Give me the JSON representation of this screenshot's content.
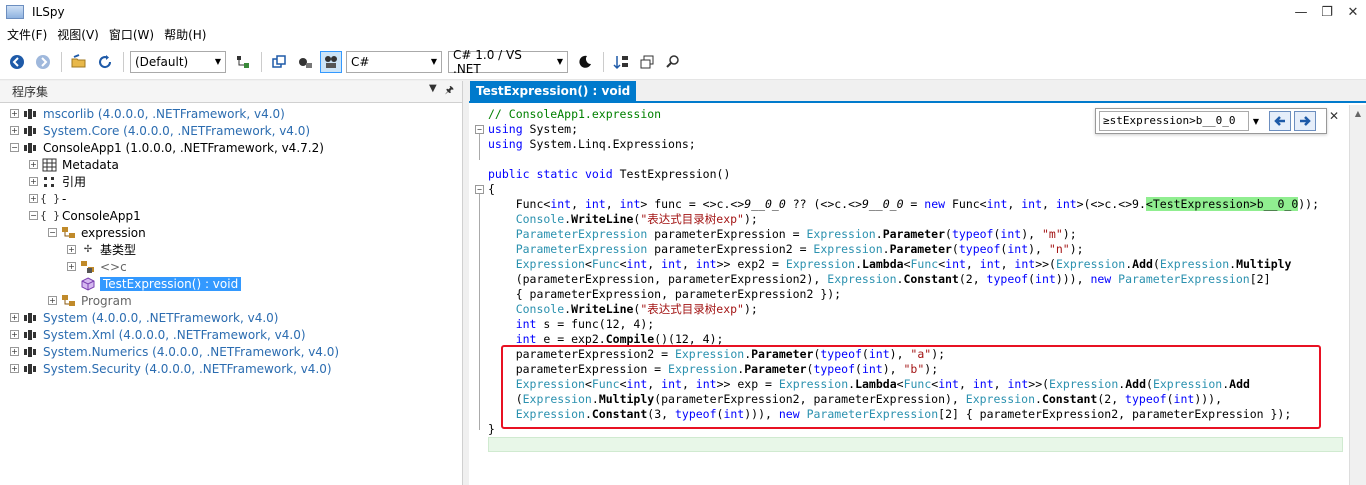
{
  "window": {
    "title": "ILSpy",
    "minimize": "—",
    "restore": "❐",
    "close": "✕"
  },
  "menu": [
    "文件(F)",
    "视图(V)",
    "窗口(W)",
    "帮助(H)"
  ],
  "toolbar": {
    "filter_combo": "(Default)",
    "language_combo": "C#",
    "version_combo": "C# 1.0 / VS .NET"
  },
  "left_panel": {
    "header": "程序集",
    "tree": [
      {
        "indent": 0,
        "expander": "+",
        "icon": "assembly-icon",
        "label": "mscorlib (4.0.0.0, .NETFramework, v4.0)",
        "style": "blue"
      },
      {
        "indent": 0,
        "expander": "+",
        "icon": "assembly-icon",
        "label": "System.Core (4.0.0.0, .NETFramework, v4.0)",
        "style": "blue"
      },
      {
        "indent": 0,
        "expander": "-",
        "icon": "assembly-icon",
        "label": "ConsoleApp1 (1.0.0.0, .NETFramework, v4.7.2)",
        "style": "normal"
      },
      {
        "indent": 1,
        "expander": "+",
        "icon": "metadata-icon",
        "label": "Metadata",
        "style": "normal"
      },
      {
        "indent": 1,
        "expander": "+",
        "icon": "reference-icon",
        "label": "引用",
        "style": "normal"
      },
      {
        "indent": 1,
        "expander": "+",
        "icon": "namespace-icon",
        "label": "-",
        "style": "normal"
      },
      {
        "indent": 1,
        "expander": "-",
        "icon": "namespace-icon",
        "label": "ConsoleApp1",
        "style": "normal"
      },
      {
        "indent": 2,
        "expander": "-",
        "icon": "class-icon",
        "label": "expression",
        "style": "normal"
      },
      {
        "indent": 3,
        "expander": "+",
        "icon": "basetype-icon",
        "label": "基类型",
        "style": "normal"
      },
      {
        "indent": 3,
        "expander": "+",
        "icon": "private-class-icon",
        "label": "<>c",
        "style": "grey"
      },
      {
        "indent": 3,
        "expander": "",
        "icon": "method-icon",
        "label": "TestExpression() : void",
        "style": "selected"
      },
      {
        "indent": 2,
        "expander": "+",
        "icon": "class-icon",
        "label": "Program",
        "style": "grey"
      },
      {
        "indent": 0,
        "expander": "+",
        "icon": "assembly-icon",
        "label": "System (4.0.0.0, .NETFramework, v4.0)",
        "style": "blue"
      },
      {
        "indent": 0,
        "expander": "+",
        "icon": "assembly-icon",
        "label": "System.Xml (4.0.0.0, .NETFramework, v4.0)",
        "style": "blue"
      },
      {
        "indent": 0,
        "expander": "+",
        "icon": "assembly-icon",
        "label": "System.Numerics (4.0.0.0, .NETFramework, v4.0)",
        "style": "blue"
      },
      {
        "indent": 0,
        "expander": "+",
        "icon": "assembly-icon",
        "label": "System.Security (4.0.0.0, .NETFramework, v4.0)",
        "style": "blue"
      }
    ]
  },
  "right_panel": {
    "tab": "TestExpression() : void",
    "search_value": "≥stExpression>b__0_0",
    "code_lines": [
      [
        [
          "cm",
          "// ConsoleApp1.expression"
        ]
      ],
      [
        [
          "kw",
          "using"
        ],
        [
          "",
          " System;"
        ]
      ],
      [
        [
          "kw",
          "using"
        ],
        [
          "",
          " System.Linq.Expressions;"
        ]
      ],
      [
        [
          "",
          ""
        ]
      ],
      [
        [
          "kw",
          "public"
        ],
        [
          "",
          " "
        ],
        [
          "kw",
          "static"
        ],
        [
          "",
          " "
        ],
        [
          "kw",
          "void"
        ],
        [
          "",
          " TestExpression()"
        ]
      ],
      [
        [
          "",
          "{"
        ]
      ],
      [
        [
          "",
          "    Func<"
        ],
        [
          "kw",
          "int"
        ],
        [
          "",
          ", "
        ],
        [
          "kw",
          "int"
        ],
        [
          "",
          ", "
        ],
        [
          "kw",
          "int"
        ],
        [
          "",
          "> func = <>c.<>"
        ],
        [
          "it",
          "9__0_0"
        ],
        [
          "",
          " ?? (<>c.<>"
        ],
        [
          "it",
          "9__0_0"
        ],
        [
          "",
          " = "
        ],
        [
          "kw",
          "new"
        ],
        [
          "",
          " Func<"
        ],
        [
          "kw",
          "int"
        ],
        [
          "",
          ", "
        ],
        [
          "kw",
          "int"
        ],
        [
          "",
          ", "
        ],
        [
          "kw",
          "int"
        ],
        [
          "",
          ">(<>c.<>9."
        ],
        [
          "hl",
          "<TestExpression>b__0_0"
        ],
        [
          "",
          "));"
        ]
      ],
      [
        [
          "ty",
          "    Console"
        ],
        [
          "",
          "."
        ],
        [
          "mt",
          "WriteLine"
        ],
        [
          "",
          "("
        ],
        [
          "str",
          "\"表达式目录树exp\""
        ],
        [
          "",
          ");"
        ]
      ],
      [
        [
          "ty",
          "    ParameterExpression"
        ],
        [
          "",
          " parameterExpression = "
        ],
        [
          "ty",
          "Expression"
        ],
        [
          "",
          "."
        ],
        [
          "mt",
          "Parameter"
        ],
        [
          "",
          "("
        ],
        [
          "kw",
          "typeof"
        ],
        [
          "",
          "("
        ],
        [
          "kw",
          "int"
        ],
        [
          "",
          "), "
        ],
        [
          "str",
          "\"m\""
        ],
        [
          "",
          ");"
        ]
      ],
      [
        [
          "ty",
          "    ParameterExpression"
        ],
        [
          "",
          " parameterExpression2 = "
        ],
        [
          "ty",
          "Expression"
        ],
        [
          "",
          "."
        ],
        [
          "mt",
          "Parameter"
        ],
        [
          "",
          "("
        ],
        [
          "kw",
          "typeof"
        ],
        [
          "",
          "("
        ],
        [
          "kw",
          "int"
        ],
        [
          "",
          "), "
        ],
        [
          "str",
          "\"n\""
        ],
        [
          "",
          ");"
        ]
      ],
      [
        [
          "ty",
          "    Expression"
        ],
        [
          "",
          "<"
        ],
        [
          "ty",
          "Func"
        ],
        [
          "",
          "<"
        ],
        [
          "kw",
          "int"
        ],
        [
          "",
          ", "
        ],
        [
          "kw",
          "int"
        ],
        [
          "",
          ", "
        ],
        [
          "kw",
          "int"
        ],
        [
          "",
          ">> exp2 = "
        ],
        [
          "ty",
          "Expression"
        ],
        [
          "",
          "."
        ],
        [
          "mt",
          "Lambda"
        ],
        [
          "",
          "<"
        ],
        [
          "ty",
          "Func"
        ],
        [
          "",
          "<"
        ],
        [
          "kw",
          "int"
        ],
        [
          "",
          ", "
        ],
        [
          "kw",
          "int"
        ],
        [
          "",
          ", "
        ],
        [
          "kw",
          "int"
        ],
        [
          "",
          ">>("
        ],
        [
          "ty",
          "Expression"
        ],
        [
          "",
          "."
        ],
        [
          "mt",
          "Add"
        ],
        [
          "",
          "("
        ],
        [
          "ty",
          "Expression"
        ],
        [
          "",
          "."
        ],
        [
          "mt",
          "Multiply"
        ]
      ],
      [
        [
          "",
          "    (parameterExpression, parameterExpression2), "
        ],
        [
          "ty",
          "Expression"
        ],
        [
          "",
          "."
        ],
        [
          "mt",
          "Constant"
        ],
        [
          "",
          "(2, "
        ],
        [
          "kw",
          "typeof"
        ],
        [
          "",
          "("
        ],
        [
          "kw",
          "int"
        ],
        [
          "",
          "))), "
        ],
        [
          "kw",
          "new"
        ],
        [
          "",
          " "
        ],
        [
          "ty",
          "ParameterExpression"
        ],
        [
          "",
          "[2]"
        ]
      ],
      [
        [
          "",
          "    { parameterExpression, parameterExpression2 });"
        ]
      ],
      [
        [
          "ty",
          "    Console"
        ],
        [
          "",
          "."
        ],
        [
          "mt",
          "WriteLine"
        ],
        [
          "",
          "("
        ],
        [
          "str",
          "\"表达式目录树exp\""
        ],
        [
          "",
          ");"
        ]
      ],
      [
        [
          "kw",
          "    int"
        ],
        [
          "",
          " s = func(12, 4);"
        ]
      ],
      [
        [
          "kw",
          "    int"
        ],
        [
          "",
          " e = exp2."
        ],
        [
          "mt",
          "Compile"
        ],
        [
          "",
          "()(12, 4);"
        ]
      ],
      [
        [
          "",
          "    parameterExpression2 = "
        ],
        [
          "ty",
          "Expression"
        ],
        [
          "",
          "."
        ],
        [
          "mt",
          "Parameter"
        ],
        [
          "",
          "("
        ],
        [
          "kw",
          "typeof"
        ],
        [
          "",
          "("
        ],
        [
          "kw",
          "int"
        ],
        [
          "",
          "), "
        ],
        [
          "str",
          "\"a\""
        ],
        [
          "",
          ");"
        ]
      ],
      [
        [
          "",
          "    parameterExpression = "
        ],
        [
          "ty",
          "Expression"
        ],
        [
          "",
          "."
        ],
        [
          "mt",
          "Parameter"
        ],
        [
          "",
          "("
        ],
        [
          "kw",
          "typeof"
        ],
        [
          "",
          "("
        ],
        [
          "kw",
          "int"
        ],
        [
          "",
          "), "
        ],
        [
          "str",
          "\"b\""
        ],
        [
          "",
          ");"
        ]
      ],
      [
        [
          "ty",
          "    Expression"
        ],
        [
          "",
          "<"
        ],
        [
          "ty",
          "Func"
        ],
        [
          "",
          "<"
        ],
        [
          "kw",
          "int"
        ],
        [
          "",
          ", "
        ],
        [
          "kw",
          "int"
        ],
        [
          "",
          ", "
        ],
        [
          "kw",
          "int"
        ],
        [
          "",
          ">> exp = "
        ],
        [
          "ty",
          "Expression"
        ],
        [
          "",
          "."
        ],
        [
          "mt",
          "Lambda"
        ],
        [
          "",
          "<"
        ],
        [
          "ty",
          "Func"
        ],
        [
          "",
          "<"
        ],
        [
          "kw",
          "int"
        ],
        [
          "",
          ", "
        ],
        [
          "kw",
          "int"
        ],
        [
          "",
          ", "
        ],
        [
          "kw",
          "int"
        ],
        [
          "",
          ">>("
        ],
        [
          "ty",
          "Expression"
        ],
        [
          "",
          "."
        ],
        [
          "mt",
          "Add"
        ],
        [
          "",
          "("
        ],
        [
          "ty",
          "Expression"
        ],
        [
          "",
          "."
        ],
        [
          "mt",
          "Add"
        ]
      ],
      [
        [
          "",
          "    ("
        ],
        [
          "ty",
          "Expression"
        ],
        [
          "",
          "."
        ],
        [
          "mt",
          "Multiply"
        ],
        [
          "",
          "(parameterExpression2, parameterExpression), "
        ],
        [
          "ty",
          "Expression"
        ],
        [
          "",
          "."
        ],
        [
          "mt",
          "Constant"
        ],
        [
          "",
          "(2, "
        ],
        [
          "kw",
          "typeof"
        ],
        [
          "",
          "("
        ],
        [
          "kw",
          "int"
        ],
        [
          "",
          "))),"
        ]
      ],
      [
        [
          "ty",
          "    Expression"
        ],
        [
          "",
          "."
        ],
        [
          "mt",
          "Constant"
        ],
        [
          "",
          "(3, "
        ],
        [
          "kw",
          "typeof"
        ],
        [
          "",
          "("
        ],
        [
          "kw",
          "int"
        ],
        [
          "",
          "))), "
        ],
        [
          "kw",
          "new"
        ],
        [
          "",
          " "
        ],
        [
          "ty",
          "ParameterExpression"
        ],
        [
          "",
          "[2] { parameterExpression2, parameterExpression });"
        ]
      ],
      [
        [
          "",
          "}"
        ]
      ],
      [
        [
          "",
          ""
        ]
      ]
    ]
  },
  "colors": {
    "accent": "#007acc",
    "highlight": "#e81123",
    "selection": "#3399ff"
  }
}
